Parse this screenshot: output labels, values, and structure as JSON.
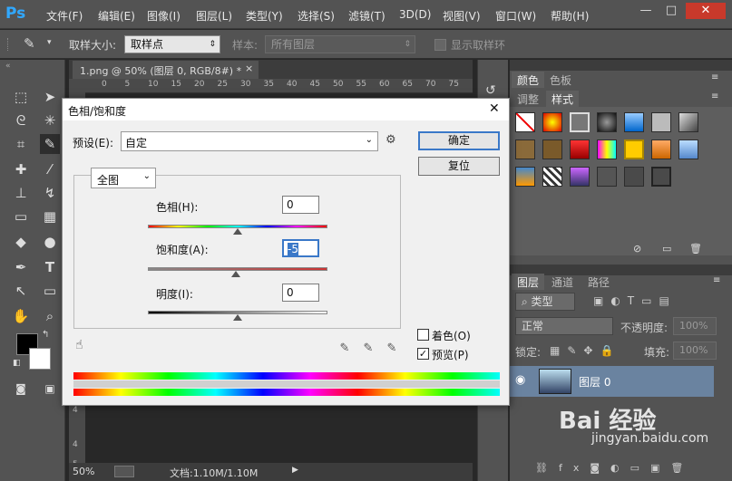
{
  "app": {
    "logo": "Ps"
  },
  "menubar": {
    "items": [
      "文件(F)",
      "编辑(E)",
      "图像(I)",
      "图层(L)",
      "类型(Y)",
      "选择(S)",
      "滤镜(T)",
      "3D(D)",
      "视图(V)",
      "窗口(W)",
      "帮助(H)"
    ],
    "window_controls": [
      "—",
      "□",
      "✕"
    ]
  },
  "options": {
    "sample_size_label": "取样大小:",
    "sample_size_value": "取样点",
    "sample_label": "样本:",
    "sample_value": "所有图层",
    "show_ring_label": "显示取样环"
  },
  "document": {
    "tab_title": "1.png @ 50% (图层 0, RGB/8#) *",
    "tab_close": "×",
    "ruler_ticks": [
      "0",
      "5",
      "10",
      "15",
      "20",
      "25",
      "30",
      "35",
      "40",
      "45",
      "50",
      "55",
      "60",
      "65",
      "70",
      "75"
    ],
    "left_ticks": [
      "4",
      "4",
      "5"
    ]
  },
  "status": {
    "zoom": "50%",
    "doc_info": "文档:1.10M/1.10M"
  },
  "panels": {
    "color_tabs": [
      "颜色",
      "色板"
    ],
    "style_tabs": [
      "调整",
      "样式"
    ],
    "layers_tabs": [
      "图层",
      "通道",
      "路径"
    ],
    "kind_filter": "类型",
    "blend_mode": "正常",
    "opacity_label": "不透明度:",
    "opacity_value": "100%",
    "lock_label": "锁定:",
    "fill_label": "填充:",
    "fill_value": "100%",
    "layer_name": "图层 0"
  },
  "dialog": {
    "title": "色相/饱和度",
    "close": "✕",
    "preset_label": "预设(E):",
    "preset_value": "自定",
    "ok": "确定",
    "reset": "复位",
    "channel": "全图",
    "hue_label": "色相(H):",
    "hue_value": "0",
    "sat_label": "饱和度(A):",
    "sat_value": "-5",
    "light_label": "明度(I):",
    "light_value": "0",
    "colorize_label": "着色(O)",
    "preview_label": "预览(P)",
    "hue_pos": 0.5,
    "sat_pos": 0.49,
    "light_pos": 0.5
  },
  "watermark": {
    "text": "Bai 经验",
    "url": "jingyan.baidu.com"
  },
  "colors": {
    "ui_dark": "#535353",
    "canvas": "#282828",
    "selected_layer": "#6a83a0",
    "dialog_accent": "#3a78c8"
  }
}
